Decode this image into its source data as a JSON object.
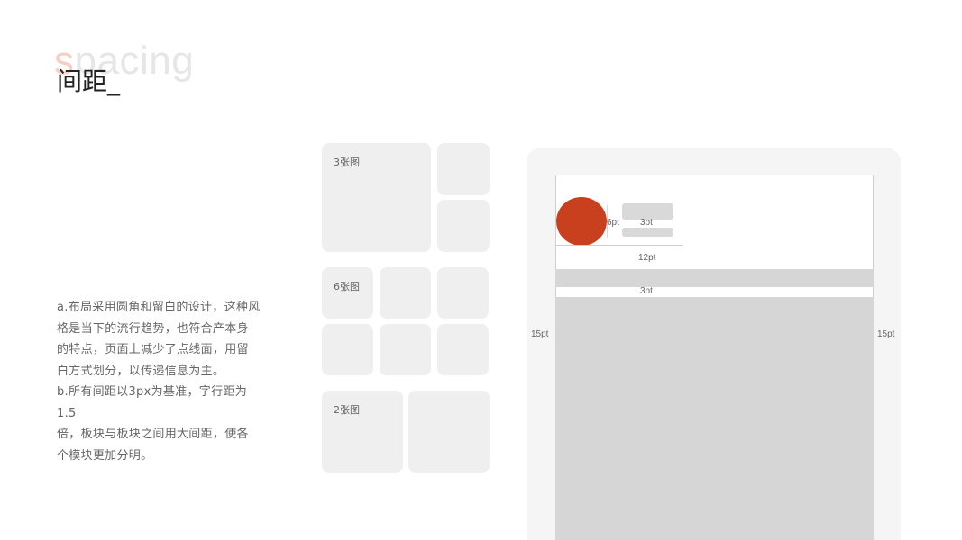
{
  "title": {
    "bg_word_first": "s",
    "bg_word_rest": "pacing",
    "main": "间距_"
  },
  "description": {
    "lines": [
      "a.布局采用圆角和留白的设计，这种风",
      "格是当下的流行趋势，也符合产本身",
      "的特点，页面上减少了点线面，用留",
      "白方式划分，以传递信息为主。",
      "b.所有间距以3px为基准，字行距为1.5",
      "倍，板块与板块之间用大间距，使各",
      "个模块更加分明。"
    ]
  },
  "grids": {
    "three_label": "3张图",
    "six_label": "6张图",
    "two_label": "2张图"
  },
  "mockup": {
    "label_6pt": "6pt",
    "label_3pt_top": "3pt",
    "label_12pt": "12pt",
    "label_3pt_mid": "3pt",
    "label_15pt_left": "15pt",
    "label_15pt_right": "15pt"
  },
  "colors": {
    "accent": "#c8401e",
    "tile": "#efefef",
    "block": "#d6d6d6"
  }
}
